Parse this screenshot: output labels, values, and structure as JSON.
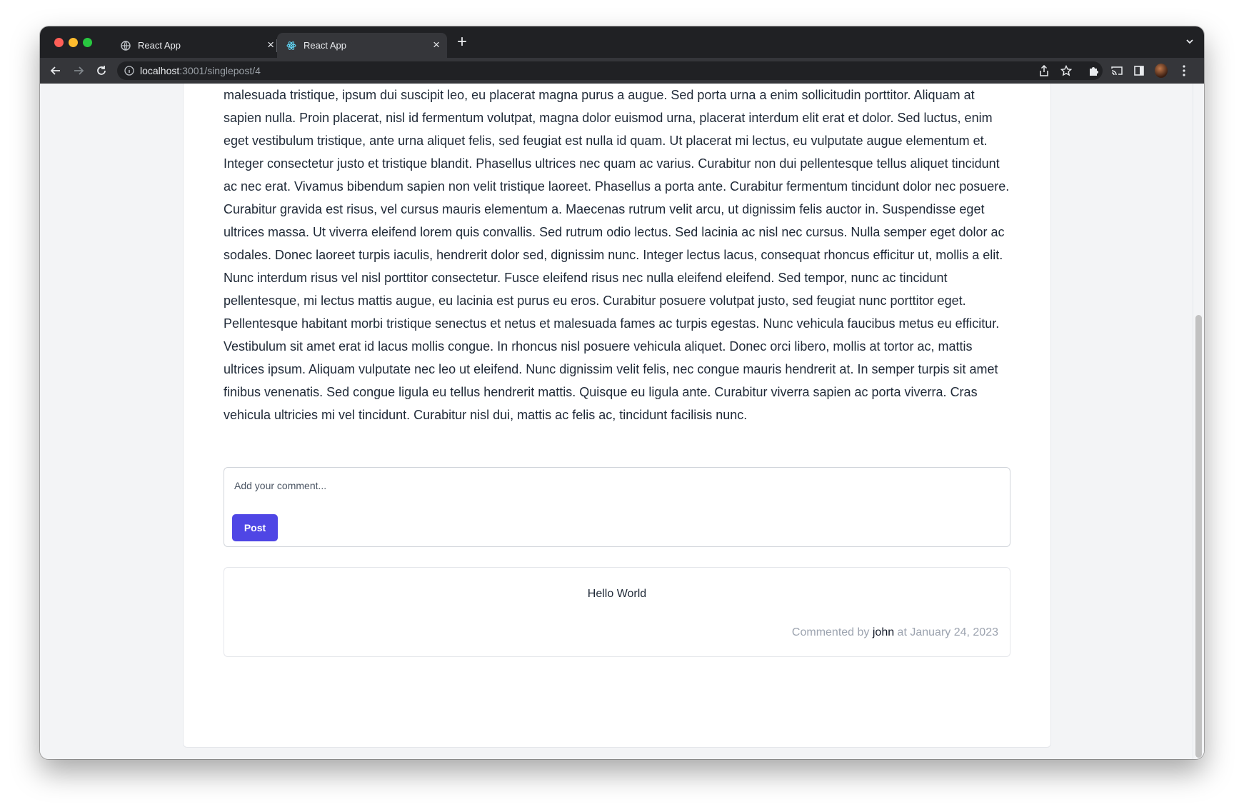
{
  "browser": {
    "tabs": [
      {
        "title": "React App",
        "active": false
      },
      {
        "title": "React App",
        "active": true
      }
    ],
    "url_host": "localhost",
    "url_path": ":3001/singlepost/4"
  },
  "post": {
    "body": "malesuada tristique, ipsum dui suscipit leo, eu placerat magna purus a augue. Sed porta urna a enim sollicitudin porttitor. Aliquam at sapien nulla. Proin placerat, nisl id fermentum volutpat, magna dolor euismod urna, placerat interdum elit erat et dolor. Sed luctus, enim eget vestibulum tristique, ante urna aliquet felis, sed feugiat est nulla id quam. Ut placerat mi lectus, eu vulputate augue elementum et. Integer consectetur justo et tristique blandit. Phasellus ultrices nec quam ac varius. Curabitur non dui pellentesque tellus aliquet tincidunt ac nec erat. Vivamus bibendum sapien non velit tristique laoreet. Phasellus a porta ante. Curabitur fermentum tincidunt dolor nec posuere. Curabitur gravida est risus, vel cursus mauris elementum a. Maecenas rutrum velit arcu, ut dignissim felis auctor in. Suspendisse eget ultrices massa. Ut viverra eleifend lorem quis convallis. Sed rutrum odio lectus. Sed lacinia ac nisl nec cursus. Nulla semper eget dolor ac sodales. Donec laoreet turpis iaculis, hendrerit dolor sed, dignissim nunc. Integer lectus lacus, consequat rhoncus efficitur ut, mollis a elit. Nunc interdum risus vel nisl porttitor consectetur. Fusce eleifend risus nec nulla eleifend eleifend. Sed tempor, nunc ac tincidunt pellentesque, mi lectus mattis augue, eu lacinia est purus eu eros. Curabitur posuere volutpat justo, sed feugiat nunc porttitor eget. Pellentesque habitant morbi tristique senectus et netus et malesuada fames ac turpis egestas. Nunc vehicula faucibus metus eu efficitur. Vestibulum sit amet erat id lacus mollis congue. In rhoncus nisl posuere vehicula aliquet. Donec orci libero, mollis at tortor ac, mattis ultrices ipsum. Aliquam vulputate nec leo ut eleifend. Nunc dignissim velit felis, nec congue mauris hendrerit at. In semper turpis sit amet finibus venenatis. Sed congue ligula eu tellus hendrerit mattis. Quisque eu ligula ante. Curabitur viverra sapien ac porta viverra. Cras vehicula ultricies mi vel tincidunt. Curabitur nisl dui, mattis ac felis ac, tincidunt facilisis nunc."
  },
  "comment_form": {
    "placeholder": "Add your comment...",
    "submit_label": "Post"
  },
  "comments": [
    {
      "text": "Hello World",
      "prefix": "Commented by ",
      "author": "john",
      "middle": " at ",
      "date": "January 24, 2023"
    }
  ],
  "colors": {
    "accent": "#4f46e5",
    "chrome_dark": "#202124",
    "page_bg": "#f3f4f6"
  }
}
